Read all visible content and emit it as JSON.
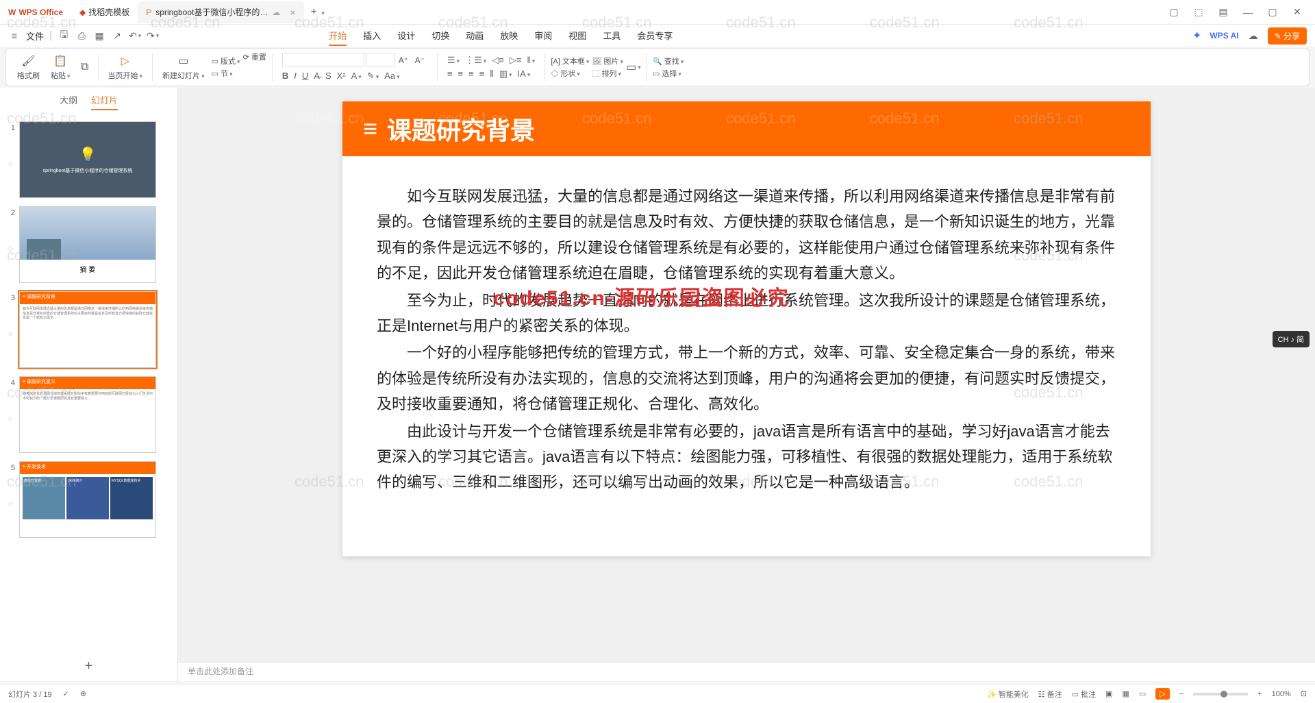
{
  "titlebar": {
    "app": "WPS Office",
    "tab_docer": "找稻壳模板",
    "tab_active": "springboot基于微信小程序的…",
    "add": "+"
  },
  "menubar": {
    "file": "文件",
    "tabs": [
      "开始",
      "插入",
      "设计",
      "切换",
      "动画",
      "放映",
      "审阅",
      "视图",
      "工具",
      "会员专享"
    ],
    "active_index": 0,
    "wps_ai": "WPS AI",
    "share": "分享"
  },
  "ribbon": {
    "format_painter": "格式刷",
    "paste": "粘贴",
    "from_current": "当页开始",
    "new_slide": "新建幻灯片",
    "layout": "版式",
    "reset": "重置",
    "section": "节",
    "textbox": "文本框",
    "shape": "形状",
    "picture": "图片",
    "arrange": "排列",
    "find": "查找",
    "select": "选择"
  },
  "thumb_panel": {
    "tab_outline": "大纲",
    "tab_slides": "幻灯片",
    "slide1_title": "springboot基于微信小程序的仓储管理系统",
    "slide2_title": "摘    要",
    "slide3_title": "课题研究背景",
    "slide4_title": "课题研究意义",
    "slide5_title": "开发技术",
    "slide5_box1": "微信开发者",
    "slide5_box2": "JAVA简介",
    "slide5_box3": "MYSQL数据库技术"
  },
  "slide": {
    "title": "课题研究背景",
    "p1": "如今互联网发展迅猛，大量的信息都是通过网络这一渠道来传播，所以利用网络渠道来传播信息是非常有前景的。仓储管理系统的主要目的就是信息及时有效、方便快捷的获取仓储信息，是一个新知识诞生的地方，光靠现有的条件是远远不够的，所以建设仓储管理系统是有必要的，这样能使用户通过仓储管理系统来弥补现有条件的不足，因此开发仓储管理系统迫在眉睫，仓储管理系统的实现有着重大意义。",
    "p2": "至今为止，时代的发展趋势一直指向的就是在网络上进行系统管理。这次我所设计的课题是仓储管理系统，正是Internet与用户的紧密关系的体现。",
    "p3": "一个好的小程序能够把传统的管理方式，带上一个新的方式，效率、可靠、安全稳定集合一身的系统，带来的体验是传统所没有办法实现的，信息的交流将达到顶峰，用户的沟通将会更加的便捷，有问题实时反馈提交，及时接收重要通知，将仓储管理正规化、合理化、高效化。",
    "p4": "由此设计与开发一个仓储管理系统是非常有必要的，java语言是所有语言中的基础，学习好java语言才能去更深入的学习其它语言。java语言有以下特点：绘图能力强，可移植性、有很强的数据处理能力，适用于系统软件的编写、三维和二维图形，还可以编写出动画的效果，所以它是一种高级语言。"
  },
  "notes": {
    "placeholder": "单击此处添加备注"
  },
  "statusbar": {
    "slide_info": "幻灯片 3 / 19",
    "beautify": "智能美化",
    "notes": "备注",
    "comments": "批注",
    "zoom": "100%"
  },
  "watermark": "code51.cn",
  "watermark_red": "code51.cn-源码乐园盗图必究",
  "ime": "CH ♪ 简"
}
